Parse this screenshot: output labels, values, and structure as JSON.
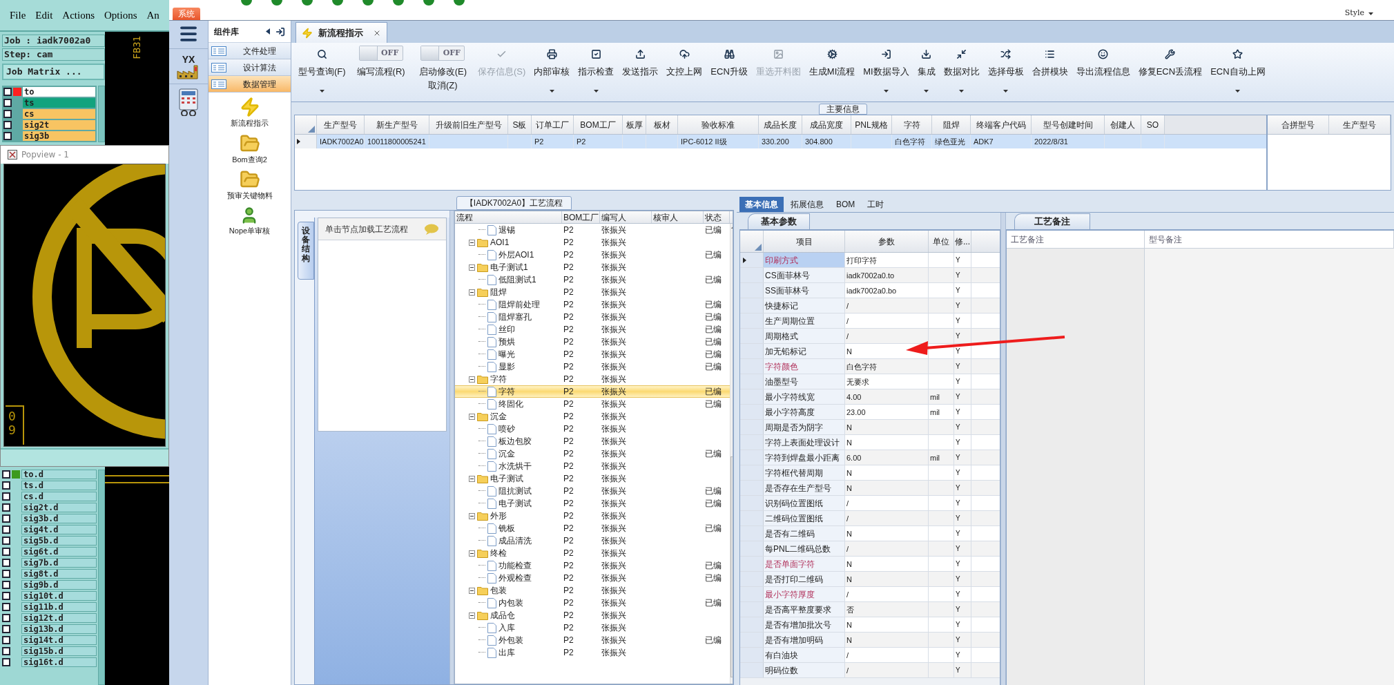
{
  "cam": {
    "menu": [
      "File",
      "Edit",
      "Actions",
      "Options",
      "An"
    ],
    "job": "Job : iadk7002a0",
    "step": "Step: cam",
    "matrix_button": "Job Matrix ...",
    "canvas_label": "FB31",
    "layers": [
      {
        "name": "to",
        "color": "#ffffff",
        "active": true,
        "checked": false
      },
      {
        "name": "ts",
        "color": "#12a37e",
        "active": false,
        "checked": false
      },
      {
        "name": "cs",
        "color": "#f8c462",
        "active": false,
        "checked": false
      },
      {
        "name": "sig2t",
        "color": "#f8c462",
        "active": false,
        "checked": false
      },
      {
        "name": "sig3b",
        "color": "#f8c462",
        "active": false,
        "checked": false
      }
    ],
    "popview": {
      "title": "Popview - 1",
      "label": "09"
    },
    "drill_layers": [
      {
        "name": "to.d",
        "active": true,
        "checked": false
      },
      {
        "name": "ts.d",
        "active": false,
        "checked": false
      },
      {
        "name": "cs.d",
        "active": false,
        "checked": false
      },
      {
        "name": "sig2t.d",
        "active": false,
        "checked": false
      },
      {
        "name": "sig3b.d",
        "active": false,
        "checked": false
      },
      {
        "name": "sig4t.d",
        "active": false,
        "checked": false
      },
      {
        "name": "sig5b.d",
        "active": false,
        "checked": false
      },
      {
        "name": "sig6t.d",
        "active": false,
        "checked": false
      },
      {
        "name": "sig7b.d",
        "active": false,
        "checked": false
      },
      {
        "name": "sig8t.d",
        "active": false,
        "checked": false
      },
      {
        "name": "sig9b.d",
        "active": false,
        "checked": false
      },
      {
        "name": "sig10t.d",
        "active": false,
        "checked": false
      },
      {
        "name": "sig11b.d",
        "active": false,
        "checked": false
      },
      {
        "name": "sig12t.d",
        "active": false,
        "checked": false
      },
      {
        "name": "sig13b.d",
        "active": false,
        "checked": false
      },
      {
        "name": "sig14t.d",
        "active": false,
        "checked": false
      },
      {
        "name": "sig15b.d",
        "active": false,
        "checked": false
      },
      {
        "name": "sig16t.d",
        "active": false,
        "checked": false
      }
    ]
  },
  "system_tab": "系统",
  "style_menu": "Style",
  "nav": {
    "logo_text": "YX"
  },
  "components": {
    "title": "组件库",
    "groups": [
      {
        "label": "文件处理",
        "selected": false
      },
      {
        "label": "设计算法",
        "selected": false
      },
      {
        "label": "数据管理",
        "selected": true
      }
    ],
    "items": [
      "新流程指示",
      "Bom查询2",
      "预审关键物料",
      "Nope单审核"
    ]
  },
  "doc_tab": {
    "label": "新流程指示"
  },
  "ribbon": [
    {
      "kind": "button",
      "label": "型号查询(F)",
      "dropdown": true,
      "disabled": false
    },
    {
      "kind": "toggle",
      "label": "编写流程(R)",
      "state_text": "OFF",
      "on": false
    },
    {
      "kind": "toggle",
      "label": "启动修改(E)",
      "sublabel": "取消(Z)",
      "state_text": "OFF",
      "on": false
    },
    {
      "kind": "button",
      "label": "保存信息(S)",
      "dropdown": false,
      "disabled": true
    },
    {
      "kind": "button",
      "label": "内部审核",
      "dropdown": true,
      "disabled": false
    },
    {
      "kind": "button",
      "label": "指示检查",
      "dropdown": true,
      "disabled": false
    },
    {
      "kind": "button",
      "label": "发送指示",
      "dropdown": false,
      "disabled": false
    },
    {
      "kind": "button",
      "label": "文控上网",
      "dropdown": false,
      "disabled": false
    },
    {
      "kind": "button",
      "label": "ECN升级",
      "dropdown": false,
      "disabled": false
    },
    {
      "kind": "button",
      "label": "重选开料图",
      "dropdown": false,
      "disabled": true
    },
    {
      "kind": "button",
      "label": "生成MI流程",
      "dropdown": false,
      "disabled": false
    },
    {
      "kind": "button",
      "label": "MI数据导入",
      "dropdown": true,
      "disabled": false
    },
    {
      "kind": "button",
      "label": "集成",
      "dropdown": true,
      "disabled": false
    },
    {
      "kind": "button",
      "label": "数据对比",
      "dropdown": true,
      "disabled": false
    },
    {
      "kind": "button",
      "label": "选择母板",
      "dropdown": true,
      "disabled": false
    },
    {
      "kind": "button",
      "label": "合拼模块",
      "dropdown": false,
      "disabled": false
    },
    {
      "kind": "button",
      "label": "导出流程信息",
      "dropdown": false,
      "disabled": false
    },
    {
      "kind": "button",
      "label": "修复ECN丢流程",
      "dropdown": false,
      "disabled": false
    },
    {
      "kind": "button",
      "label": "ECN自动上网",
      "dropdown": true,
      "disabled": false
    }
  ],
  "main_info": {
    "title": "主要信息",
    "columns": [
      "生产型号",
      "新生产型号",
      "升级前旧生产型号",
      "S板",
      "订单工厂",
      "BOM工厂",
      "板厚",
      "板材",
      "验收标准",
      "成品长度",
      "成品宽度",
      "PNL规格",
      "字符",
      "阻焊",
      "终端客户代码",
      "型号创建时间",
      "创建人",
      "SO"
    ],
    "rows": [
      {
        "selected": true,
        "cells": [
          "IADK7002A0",
          "10011800005241",
          null,
          null,
          "P2",
          "P2",
          null,
          null,
          "IPC-6012 II级",
          "330.200",
          "304.800",
          null,
          "白色字符",
          "绿色亚光",
          "ADK7",
          "2022/8/31",
          null,
          null
        ]
      }
    ],
    "merge_columns": [
      "合拼型号",
      "生产型号"
    ]
  },
  "flow": {
    "title": "【IADK7002A0】工艺流程",
    "side_tab": "设备结构",
    "hint": "单击节点加载工艺流程",
    "columns": [
      "流程",
      "BOM工厂",
      "编写人",
      "核审人",
      "状态"
    ],
    "rows": [
      {
        "kind": "leaf",
        "name": "退锡",
        "bom": "P2",
        "writer": "张振兴",
        "status": "已编",
        "selected": false
      },
      {
        "kind": "folder",
        "name": "AOI1",
        "bom": "P2",
        "writer": "张振兴",
        "expanded": true,
        "selected": false,
        "children": [
          {
            "kind": "leaf",
            "name": "外层AOI1",
            "bom": "P2",
            "writer": "张振兴",
            "status": "已编",
            "selected": false
          }
        ]
      },
      {
        "kind": "folder",
        "name": "电子测试1",
        "bom": "P2",
        "writer": "张振兴",
        "expanded": true,
        "selected": false,
        "children": [
          {
            "kind": "leaf",
            "name": "低阻测试1",
            "bom": "P2",
            "writer": "张振兴",
            "status": "已编",
            "selected": false
          }
        ]
      },
      {
        "kind": "folder",
        "name": "阻焊",
        "bom": "P2",
        "writer": "张振兴",
        "expanded": true,
        "selected": false,
        "children": [
          {
            "kind": "leaf",
            "name": "阻焊前处理",
            "bom": "P2",
            "writer": "张振兴",
            "status": "已编",
            "selected": false
          },
          {
            "kind": "leaf",
            "name": "阻焊塞孔",
            "bom": "P2",
            "writer": "张振兴",
            "status": "已编",
            "selected": false
          },
          {
            "kind": "leaf",
            "name": "丝印",
            "bom": "P2",
            "writer": "张振兴",
            "status": "已编",
            "selected": false
          },
          {
            "kind": "leaf",
            "name": "预烘",
            "bom": "P2",
            "writer": "张振兴",
            "status": "已编",
            "selected": false
          },
          {
            "kind": "leaf",
            "name": "曝光",
            "bom": "P2",
            "writer": "张振兴",
            "status": "已编",
            "selected": false
          },
          {
            "kind": "leaf",
            "name": "显影",
            "bom": "P2",
            "writer": "张振兴",
            "status": "已编",
            "selected": false
          }
        ]
      },
      {
        "kind": "folder",
        "name": "字符",
        "bom": "P2",
        "writer": "张振兴",
        "expanded": true,
        "selected": false,
        "children": [
          {
            "kind": "leaf",
            "name": "字符",
            "bom": "P2",
            "writer": "张振兴",
            "status": "已编",
            "selected": true
          },
          {
            "kind": "leaf",
            "name": "终固化",
            "bom": "P2",
            "writer": "张振兴",
            "status": "已编",
            "selected": false
          }
        ]
      },
      {
        "kind": "folder",
        "name": "沉金",
        "bom": "P2",
        "writer": "张振兴",
        "expanded": true,
        "selected": false,
        "children": [
          {
            "kind": "leaf",
            "name": "喷砂",
            "bom": "P2",
            "writer": "张振兴",
            "selected": false
          },
          {
            "kind": "leaf",
            "name": "板边包胶",
            "bom": "P2",
            "writer": "张振兴",
            "selected": false
          },
          {
            "kind": "leaf",
            "name": "沉金",
            "bom": "P2",
            "writer": "张振兴",
            "status": "已编",
            "selected": false
          },
          {
            "kind": "leaf",
            "name": "水洗烘干",
            "bom": "P2",
            "writer": "张振兴",
            "selected": false
          }
        ]
      },
      {
        "kind": "folder",
        "name": "电子测试",
        "bom": "P2",
        "writer": "张振兴",
        "expanded": true,
        "selected": false,
        "children": [
          {
            "kind": "leaf",
            "name": "阻抗测试",
            "bom": "P2",
            "writer": "张振兴",
            "status": "已编",
            "selected": false
          },
          {
            "kind": "leaf",
            "name": "电子测试",
            "bom": "P2",
            "writer": "张振兴",
            "status": "已编",
            "selected": false
          }
        ]
      },
      {
        "kind": "folder",
        "name": "外形",
        "bom": "P2",
        "writer": "张振兴",
        "expanded": true,
        "selected": false,
        "children": [
          {
            "kind": "leaf",
            "name": "铣板",
            "bom": "P2",
            "writer": "张振兴",
            "status": "已编",
            "selected": false
          },
          {
            "kind": "leaf",
            "name": "成品清洗",
            "bom": "P2",
            "writer": "张振兴",
            "selected": false
          }
        ]
      },
      {
        "kind": "folder",
        "name": "终检",
        "bom": "P2",
        "writer": "张振兴",
        "expanded": true,
        "selected": false,
        "children": [
          {
            "kind": "leaf",
            "name": "功能检查",
            "bom": "P2",
            "writer": "张振兴",
            "status": "已编",
            "selected": false
          },
          {
            "kind": "leaf",
            "name": "外观检查",
            "bom": "P2",
            "writer": "张振兴",
            "status": "已编",
            "selected": false
          }
        ]
      },
      {
        "kind": "folder",
        "name": "包装",
        "bom": "P2",
        "writer": "张振兴",
        "expanded": true,
        "selected": false,
        "children": [
          {
            "kind": "leaf",
            "name": "内包装",
            "bom": "P2",
            "writer": "张振兴",
            "status": "已编",
            "selected": false
          }
        ]
      },
      {
        "kind": "folder",
        "name": "成品仓",
        "bom": "P2",
        "writer": "张振兴",
        "expanded": true,
        "selected": false,
        "children": [
          {
            "kind": "leaf",
            "name": "入库",
            "bom": "P2",
            "writer": "张振兴",
            "selected": false
          },
          {
            "kind": "leaf",
            "name": "外包装",
            "bom": "P2",
            "writer": "张振兴",
            "status": "已编",
            "selected": false
          },
          {
            "kind": "leaf",
            "name": "出库",
            "bom": "P2",
            "writer": "张振兴",
            "selected": false
          }
        ]
      }
    ]
  },
  "detail_tabs": [
    {
      "label": "基本信息",
      "selected": true
    },
    {
      "label": "拓展信息",
      "selected": false
    },
    {
      "label": "BOM",
      "selected": false
    },
    {
      "label": "工时",
      "selected": false
    }
  ],
  "params": {
    "tab": "基本参数",
    "columns": [
      "项目",
      "参数",
      "单位",
      "修..."
    ],
    "rows": [
      {
        "item": "印刷方式",
        "value": "打印字符",
        "modified": "Y",
        "highlighted": true,
        "selected": true
      },
      {
        "item": "CS面菲林号",
        "value": "iadk7002a0.to",
        "modified": "Y",
        "highlighted": false,
        "selected": false
      },
      {
        "item": "SS面菲林号",
        "value": "iadk7002a0.bo",
        "modified": "Y",
        "highlighted": false,
        "selected": false
      },
      {
        "item": "快捷标记",
        "value": "/",
        "modified": "Y",
        "highlighted": false,
        "selected": false
      },
      {
        "item": "生产周期位置",
        "value": "/",
        "modified": "Y",
        "highlighted": false,
        "selected": false
      },
      {
        "item": "周期格式",
        "value": "/",
        "modified": "Y",
        "highlighted": false,
        "selected": false
      },
      {
        "item": "加无铅标记",
        "value": "N",
        "modified": "Y",
        "highlighted": false,
        "selected": false
      },
      {
        "item": "字符颜色",
        "value": "白色字符",
        "modified": "Y",
        "highlighted": true,
        "selected": false
      },
      {
        "item": "油墨型号",
        "value": "无要求",
        "modified": "Y",
        "highlighted": false,
        "selected": false
      },
      {
        "item": "最小字符线宽",
        "value": "4.00",
        "unit": "mil",
        "modified": "Y",
        "highlighted": false,
        "selected": false
      },
      {
        "item": "最小字符高度",
        "value": "23.00",
        "unit": "mil",
        "modified": "Y",
        "highlighted": false,
        "selected": false
      },
      {
        "item": "周期是否为阴字",
        "value": "N",
        "modified": "Y",
        "highlighted": false,
        "selected": false
      },
      {
        "item": "字符上表面处理设计",
        "value": "N",
        "modified": "Y",
        "highlighted": false,
        "selected": false
      },
      {
        "item": "字符到焊盘最小距离",
        "value": "6.00",
        "unit": "mil",
        "modified": "Y",
        "highlighted": false,
        "selected": false
      },
      {
        "item": "字符框代替周期",
        "value": "N",
        "modified": "Y",
        "highlighted": false,
        "selected": false
      },
      {
        "item": "是否存在生产型号",
        "value": "N",
        "modified": "Y",
        "highlighted": false,
        "selected": false
      },
      {
        "item": "识别码位置图纸",
        "value": "/",
        "modified": "Y",
        "highlighted": false,
        "selected": false
      },
      {
        "item": "二维码位置图纸",
        "value": "/",
        "modified": "Y",
        "highlighted": false,
        "selected": false
      },
      {
        "item": "是否有二维码",
        "value": "N",
        "modified": "Y",
        "highlighted": false,
        "selected": false
      },
      {
        "item": "每PNL二维码总数",
        "value": "/",
        "modified": "Y",
        "highlighted": false,
        "selected": false
      },
      {
        "item": "是否单面字符",
        "value": "N",
        "modified": "Y",
        "highlighted": true,
        "selected": false
      },
      {
        "item": "是否打印二维码",
        "value": "N",
        "modified": "Y",
        "highlighted": false,
        "selected": false
      },
      {
        "item": "最小字符厚度",
        "value": "/",
        "modified": "Y",
        "highlighted": true,
        "selected": false
      },
      {
        "item": "是否高平整度要求",
        "value": "否",
        "modified": "Y",
        "highlighted": false,
        "selected": false
      },
      {
        "item": "是否有增加批次号",
        "value": "N",
        "modified": "Y",
        "highlighted": false,
        "selected": false
      },
      {
        "item": "是否有增加明码",
        "value": "N",
        "modified": "Y",
        "highlighted": false,
        "selected": false
      },
      {
        "item": "有白油块",
        "value": "/",
        "modified": "Y",
        "highlighted": false,
        "selected": false
      },
      {
        "item": "明码位数",
        "value": "/",
        "modified": "Y",
        "highlighted": false,
        "selected": false
      }
    ]
  },
  "notes": {
    "tab": "工艺备注",
    "columns": [
      "工艺备注",
      "型号备注"
    ]
  }
}
